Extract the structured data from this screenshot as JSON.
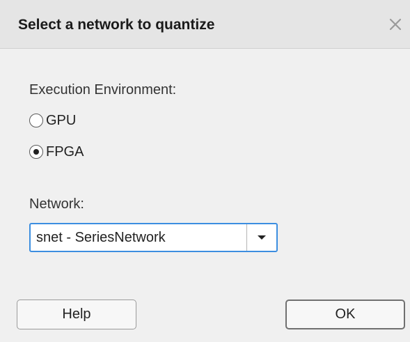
{
  "dialog": {
    "title": "Select a network to quantize",
    "close_icon": "close-icon"
  },
  "execution_environment": {
    "label": "Execution Environment:",
    "options": [
      {
        "label": "GPU",
        "selected": false
      },
      {
        "label": "FPGA",
        "selected": true
      }
    ]
  },
  "network": {
    "label": "Network:",
    "selected_value": "snet - SeriesNetwork",
    "arrow_icon": "caret-down-icon",
    "focus_color": "#3c8ee0"
  },
  "buttons": {
    "help_label": "Help",
    "ok_label": "OK"
  }
}
